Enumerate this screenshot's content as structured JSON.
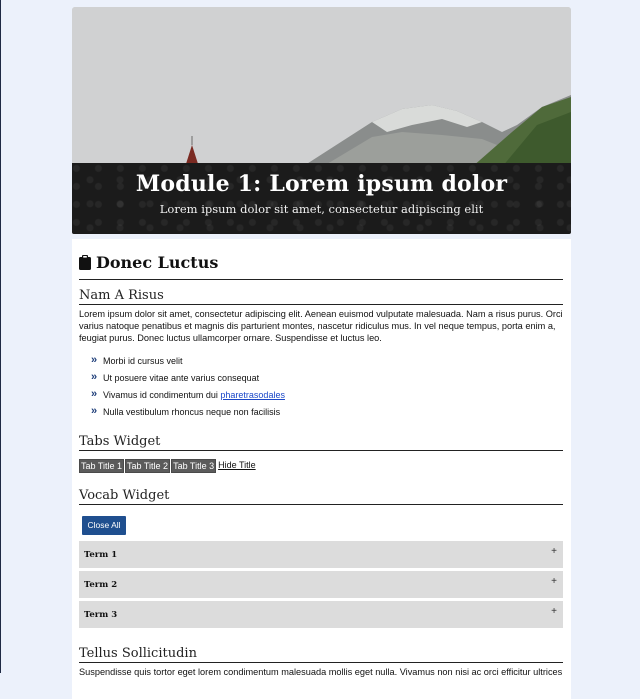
{
  "banner": {
    "title": "Module 1: Lorem ipsum dolor",
    "subtitle": "Lorem ipsum dolor sit amet, consectetur adipiscing elit"
  },
  "module": {
    "heading": "Donec Luctus",
    "heading_icon": "clipboard-icon"
  },
  "section1": {
    "title": "Nam A Risus",
    "paragraph_lines": [
      "Lorem ipsum dolor sit amet, consectetur adipiscing elit. Aenean euismod vulputate malesuada. Nam a risus purus. Orci",
      "varius natoque penatibus et magnis dis parturient montes, nascetur ridiculus mus. In vel neque tempus, porta enim a,",
      "feugiat purus. Donec luctus ullamcorper ornare. Suspendisse et luctus leo."
    ],
    "bullets": [
      {
        "text": "Morbi id cursus velit"
      },
      {
        "text": "Ut posuere vitae ante varius consequat"
      },
      {
        "text": "Vivamus id condimentum dui ",
        "link": "pharetrasodales"
      },
      {
        "text": "Nulla vestibulum rhoncus neque non facilisis"
      }
    ],
    "bullet_icon": "double-chevron-right-icon"
  },
  "tabs_widget": {
    "title": "Tabs Widget",
    "tabs": [
      "Tab Title 1",
      "Tab Title 2",
      "Tab Title 3"
    ],
    "hide_label": "Hide Title"
  },
  "vocab_widget": {
    "title": "Vocab Widget",
    "close_all_label": "Close All",
    "terms": [
      "Term 1",
      "Term 2",
      "Term 3"
    ],
    "expand_symbol": "+"
  },
  "section2": {
    "title": "Tellus Sollicitudin",
    "paragraph_line": "Suspendisse quis tortor eget lorem condimentum malesuada mollis eget nulla. Vivamus non nisi ac orci efficitur ultrices"
  },
  "colors": {
    "page_bg": "#ecf1fb",
    "banner_overlay": "#1b1b1b",
    "accent_button": "#1f4f8f",
    "tab_bg": "#5b5b5b",
    "term_bg": "#dcdcdc",
    "link": "#1a47c8"
  }
}
